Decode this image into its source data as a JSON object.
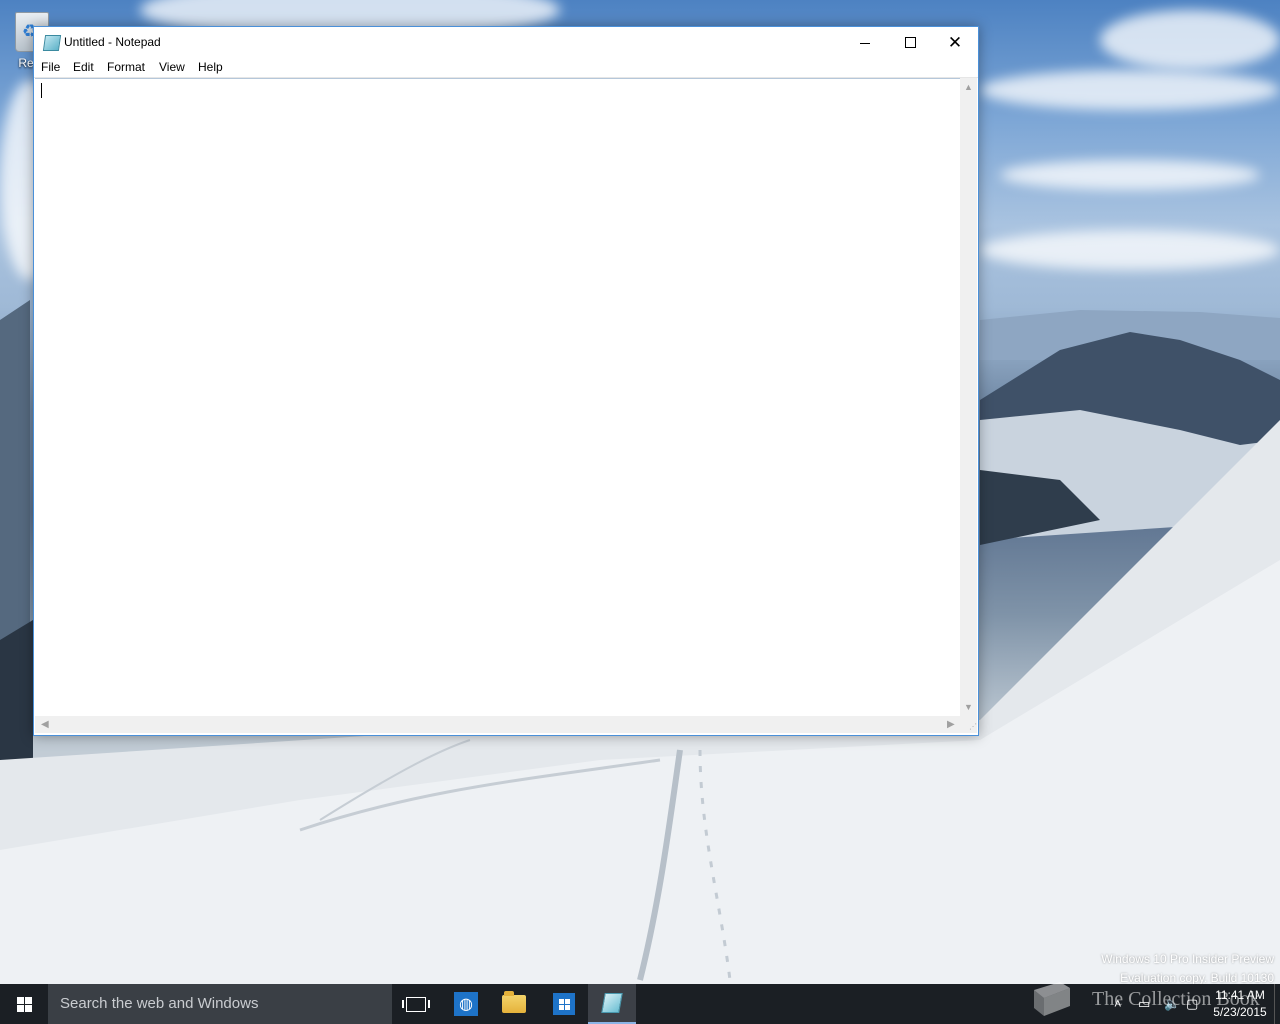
{
  "desktop": {
    "recycle_bin_label": "Recy"
  },
  "window": {
    "title": "Untitled - Notepad",
    "menu": [
      "File",
      "Edit",
      "Format",
      "View",
      "Help"
    ],
    "editor_text": ""
  },
  "watermark": {
    "line1": "Windows 10 Pro Insider Preview",
    "line2": "Evaluation copy. Build 10130"
  },
  "taskbar": {
    "search_placeholder": "Search the web and Windows",
    "clock_time": "11:41 AM",
    "clock_date": "5/23/2015",
    "pinned": [
      "browser-icon",
      "file-explorer-icon",
      "store-icon",
      "notepad-icon"
    ]
  },
  "brand": {
    "text": "The Collection Book"
  },
  "colors": {
    "taskbar_bg": "#1b1f24",
    "search_bg": "#3a3f45",
    "window_border": "#4a90d9",
    "accent": "#1e73c8"
  }
}
